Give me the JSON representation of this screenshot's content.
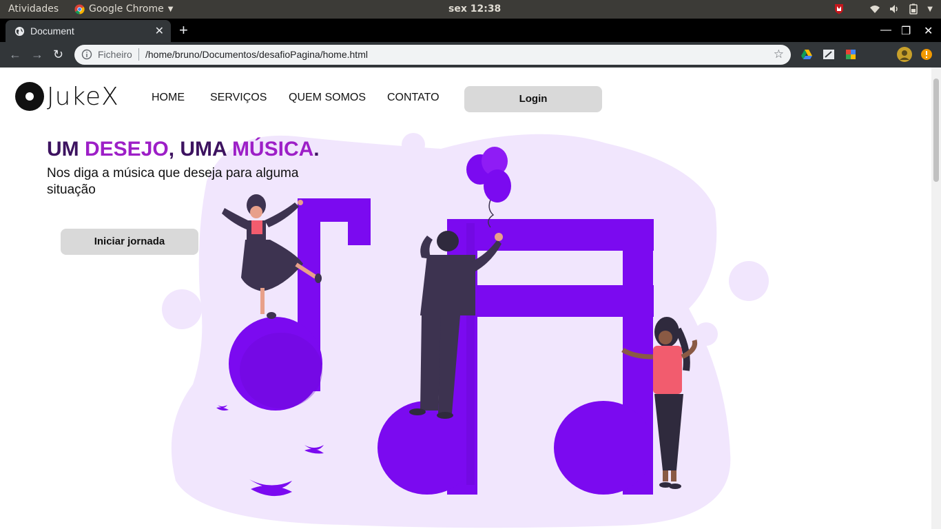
{
  "system": {
    "activities": "Atividades",
    "app_name": "Google Chrome",
    "clock": "sex 12:38"
  },
  "browser": {
    "tab_title": "Document",
    "scheme_label": "Ficheiro",
    "url": "/home/bruno/Documentos/desafioPagina/home.html"
  },
  "site": {
    "brand": "JukeX",
    "nav": [
      "HOME",
      "SERVIÇOS",
      "QUEM SOMOS",
      "CONTATO"
    ],
    "login_label": "Login",
    "headline": {
      "part1": "UM ",
      "part2": "DESEJO",
      "part3": ", UMA ",
      "part4": "MÚSICA",
      "part5": "."
    },
    "subtitle": "Nos diga a música que deseja para alguma situação",
    "cta_label": "Iniciar jornada"
  },
  "colors": {
    "primary_purple": "#7b0af0",
    "headline_dark": "#3d1360",
    "headline_accent": "#9d1fc7",
    "blob": "#f1e6fd"
  }
}
